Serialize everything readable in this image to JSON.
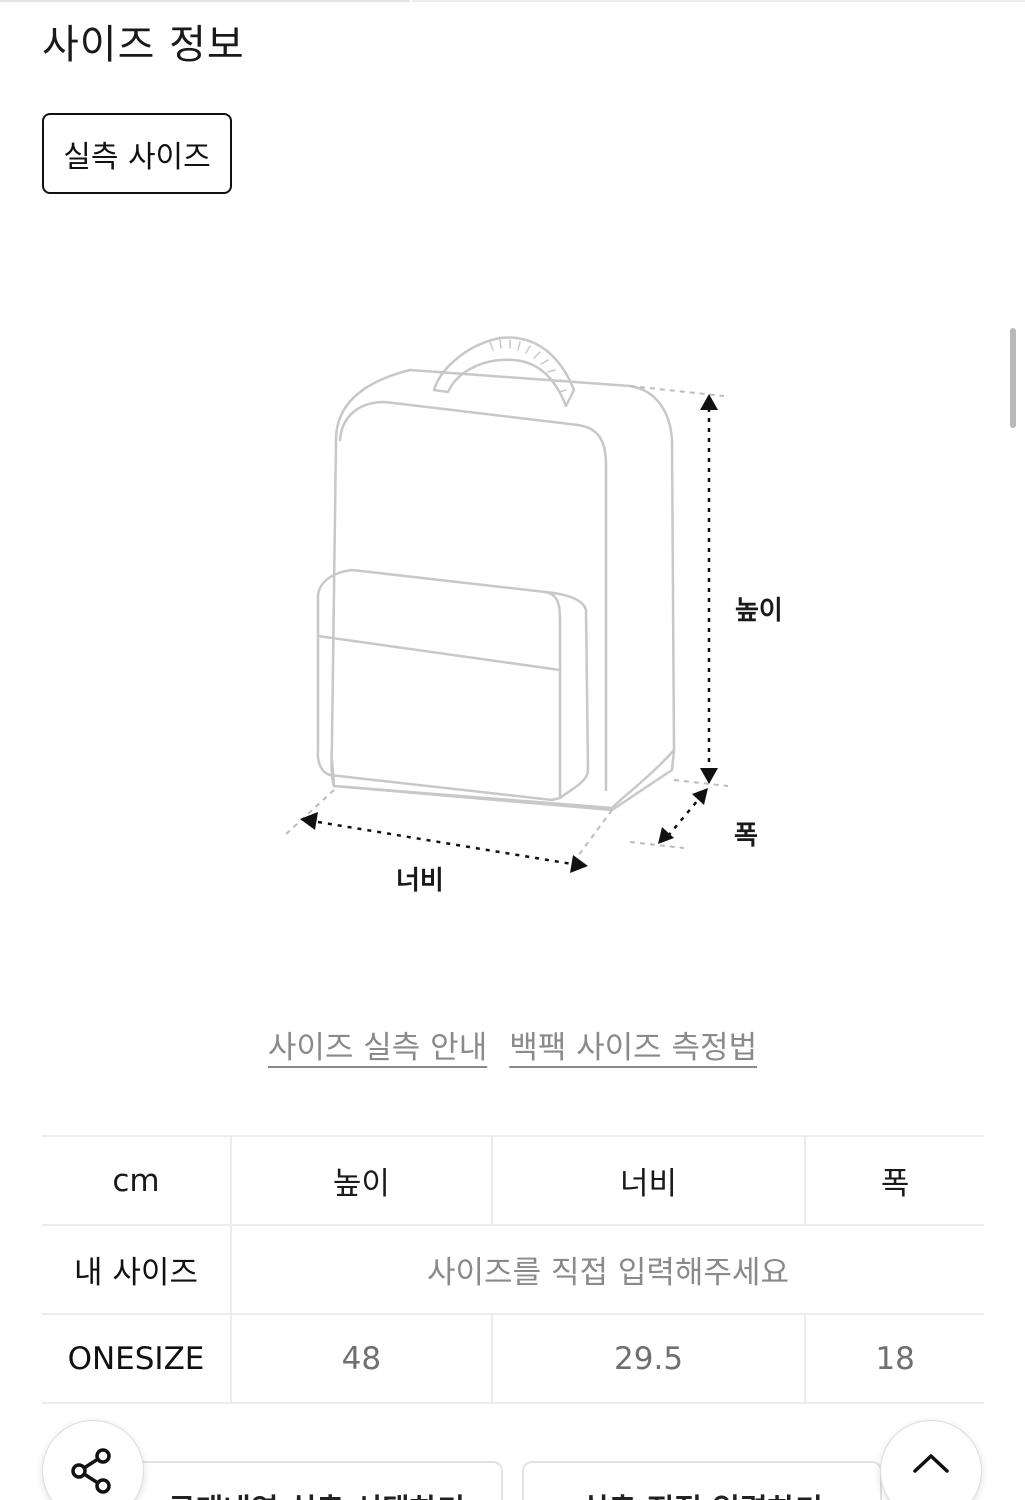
{
  "section": {
    "title": "사이즈 정보"
  },
  "tabs": [
    {
      "label": "실측 사이즈",
      "selected": true
    }
  ],
  "diagram": {
    "subject": "backpack",
    "labels": {
      "height": "높이",
      "width": "너비",
      "depth": "폭"
    }
  },
  "links": {
    "guide": "사이즈 실측 안내",
    "backpack_method": "백팩 사이즈 측정법"
  },
  "table": {
    "unit": "cm",
    "headers": [
      "높이",
      "너비",
      "폭"
    ],
    "my_size": {
      "label": "내 사이즈",
      "placeholder": "사이즈를 직접 입력해주세요"
    },
    "rows": [
      {
        "size": "ONESIZE",
        "values": [
          "48",
          "29.5",
          "18"
        ]
      }
    ]
  },
  "bottom_bar": {
    "share_icon": "share-icon",
    "top_icon": "chevron-up-icon",
    "left_button": "구매내역 실측 선택하기",
    "right_button": "실측 직접 입력하기"
  },
  "colors": {
    "text": "#111111",
    "muted": "#8a8a8a",
    "border": "#ececec",
    "diagram_stroke": "#c8c8c8"
  }
}
